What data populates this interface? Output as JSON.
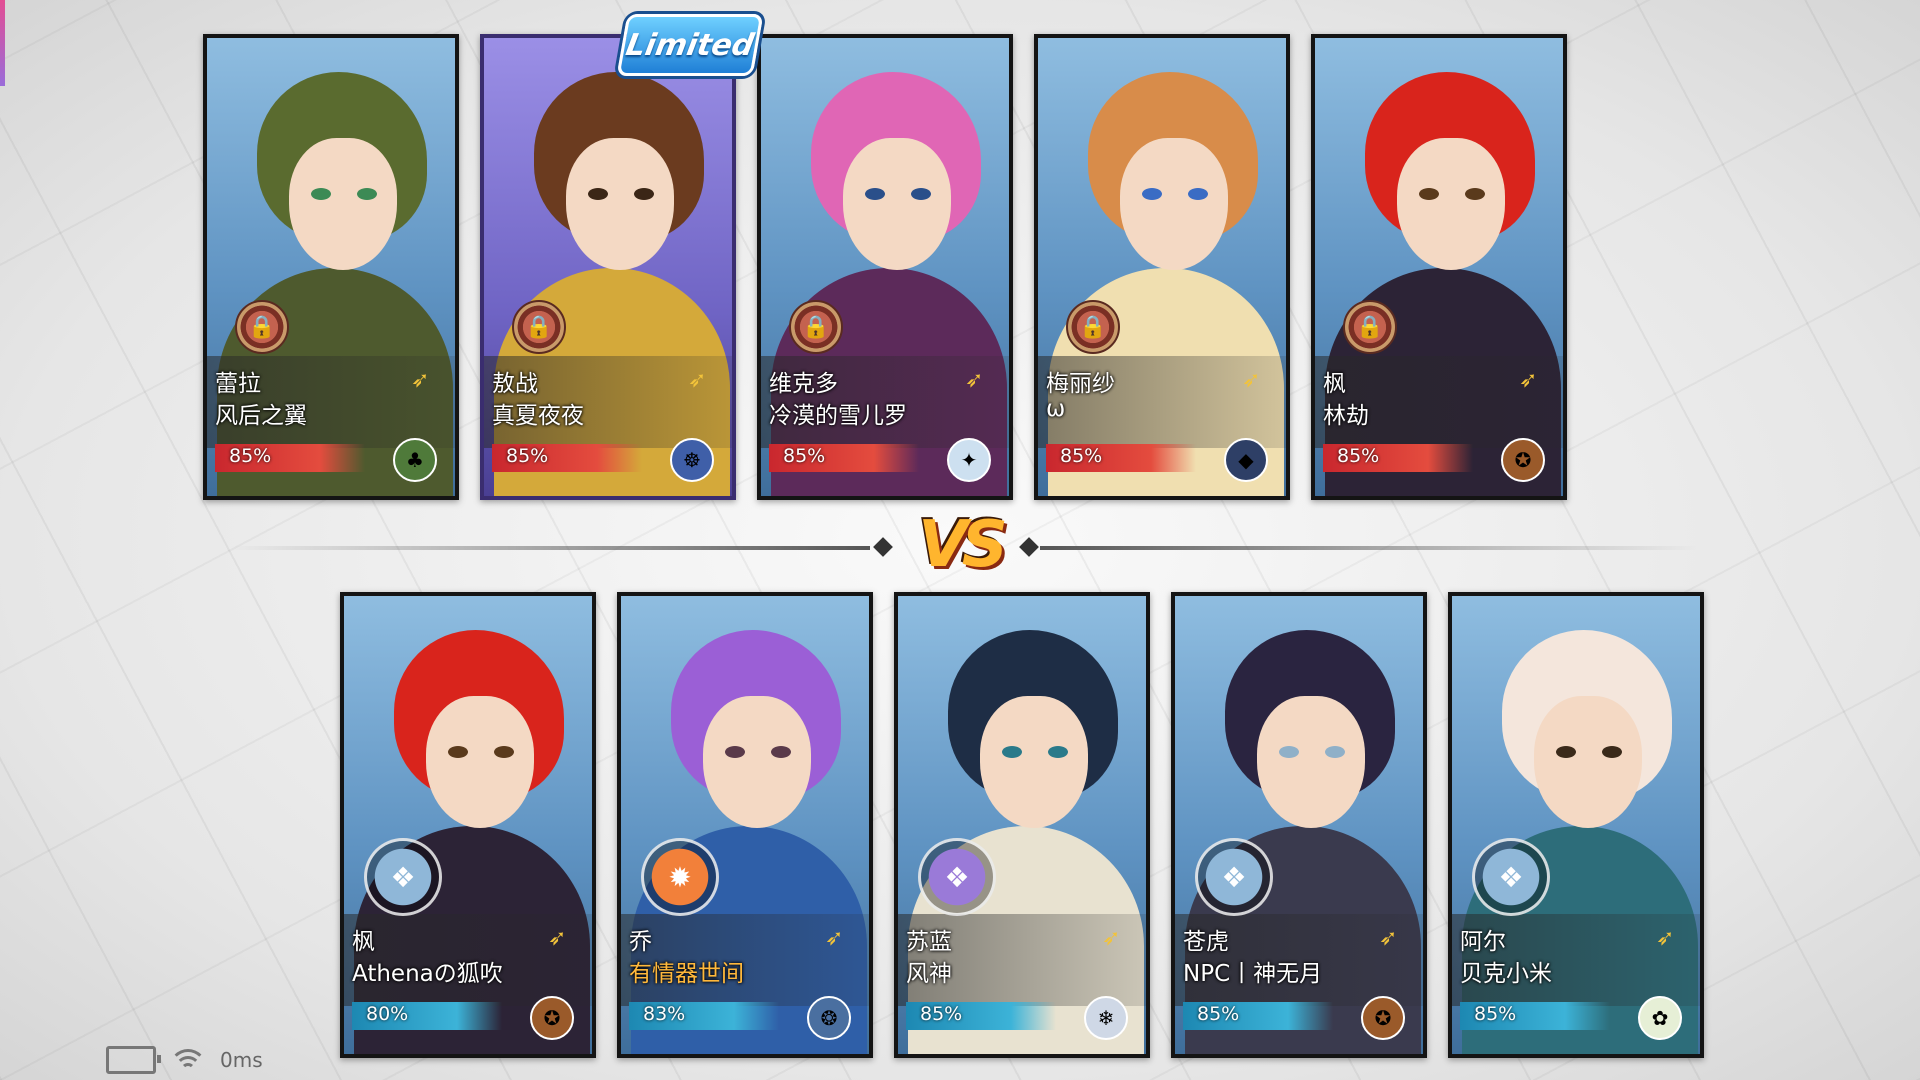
{
  "limited_label": "Limited",
  "vs_label": "VS",
  "status": {
    "ping": "0ms"
  },
  "top_team": [
    {
      "name1": "蕾拉",
      "name2": "风后之翼",
      "percent": "85%",
      "hair": "#5a6b2f",
      "body": "#4e5a2e",
      "eye": "#3c8a55",
      "avatar": "#4f7a3a",
      "avatar_icon": "♣"
    },
    {
      "name1": "敖战",
      "name2": "真夏夜夜",
      "percent": "85%",
      "hair": "#6b3b1f",
      "body": "#d4a93a",
      "eye": "#3b2616",
      "avatar": "#3f5fa8",
      "avatar_icon": "☸",
      "limited": true
    },
    {
      "name1": "维克多",
      "name2": "冷漠的雪儿罗",
      "percent": "85%",
      "hair": "#e066b5",
      "body": "#5c2a5a",
      "eye": "#2a4f8a",
      "avatar": "#cde0f0",
      "avatar_icon": "✦"
    },
    {
      "name1": "梅丽纱",
      "name2": "ω",
      "percent": "85%",
      "hair": "#d88c4a",
      "body": "#f0dfb0",
      "eye": "#3a6cc4",
      "avatar": "#2e3f66",
      "avatar_icon": "◆"
    },
    {
      "name1": "枫",
      "name2": "林劫",
      "percent": "85%",
      "hair": "#d9241c",
      "body": "#2c2336",
      "eye": "#5a3a1c",
      "avatar": "#9a5a2a",
      "avatar_icon": "✪"
    }
  ],
  "bottom_team": [
    {
      "name1": "枫",
      "name2": "Athenaの狐吹",
      "percent": "80%",
      "hair": "#d9241c",
      "body": "#2c2336",
      "eye": "#5a3a1c",
      "avatar": "#9a5a2a",
      "avatar_icon": "✪",
      "badge": "#8fb7d8",
      "badge_icon": "❖"
    },
    {
      "name1": "乔",
      "name2": "有情器世间",
      "percent": "83%",
      "hair": "#9b5fd6",
      "body": "#2f5fa8",
      "eye": "#5a3a4a",
      "avatar": "#4a6fa0",
      "avatar_icon": "❂",
      "badge": "#f2803a",
      "badge_icon": "✹",
      "gold": true
    },
    {
      "name1": "苏蓝",
      "name2": "风神",
      "percent": "85%",
      "hair": "#1e2d45",
      "body": "#e8e2d0",
      "eye": "#2a7a8a",
      "avatar": "#cfd8e6",
      "avatar_icon": "❄",
      "badge": "#9a7ad8",
      "badge_icon": "❖"
    },
    {
      "name1": "苍虎",
      "name2": "NPC丨神无月",
      "percent": "85%",
      "hair": "#2a2440",
      "body": "#3a3a4e",
      "eye": "#8fb0c8",
      "avatar": "#9a5a2a",
      "avatar_icon": "✪",
      "badge": "#8fb7d8",
      "badge_icon": "❖"
    },
    {
      "name1": "阿尔",
      "name2": "贝克小米",
      "percent": "85%",
      "hair": "#f4e6dc",
      "body": "#2d6d7a",
      "eye": "#3a2a1a",
      "avatar": "#e6efd6",
      "avatar_icon": "✿",
      "badge": "#8fb7d8",
      "badge_icon": "❖"
    }
  ]
}
